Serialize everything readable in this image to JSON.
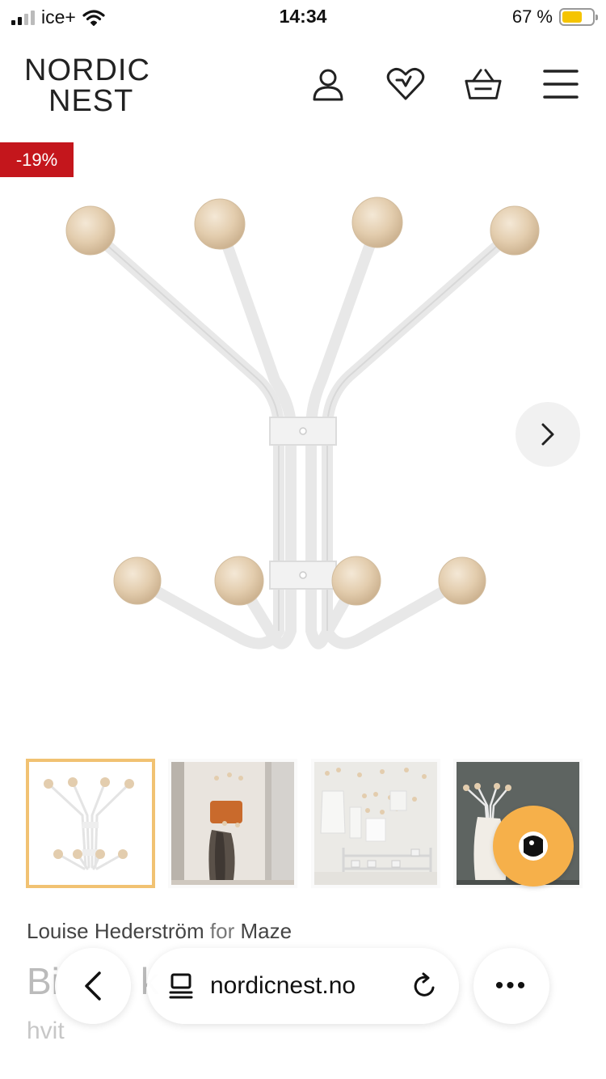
{
  "status_bar": {
    "carrier": "ice+",
    "time": "14:34",
    "battery": "67 %",
    "battery_level": 0.67
  },
  "header": {
    "logo_line1": "NORDIC",
    "logo_line2": "NEST",
    "icons": [
      "user-icon",
      "heart-icon",
      "basket-icon",
      "menu-icon"
    ]
  },
  "product": {
    "discount_badge": "-19%",
    "designer": "Louise Hederström",
    "for_word": "for",
    "brand": "Maze",
    "title_partial_1": "Bi",
    "title_partial_2": "k",
    "variant": "hvit"
  },
  "gallery": {
    "thumbnails": [
      "thumbnail-1",
      "thumbnail-2",
      "thumbnail-3",
      "thumbnail-4"
    ],
    "active_index": 0
  },
  "browser": {
    "url": "nordicnest.no",
    "more_label": "•••"
  },
  "colors": {
    "discount_red": "#c4161c",
    "thumb_active_border": "#f1c272",
    "chat_orange": "#f6b04a",
    "battery_yellow": "#f5c400"
  }
}
